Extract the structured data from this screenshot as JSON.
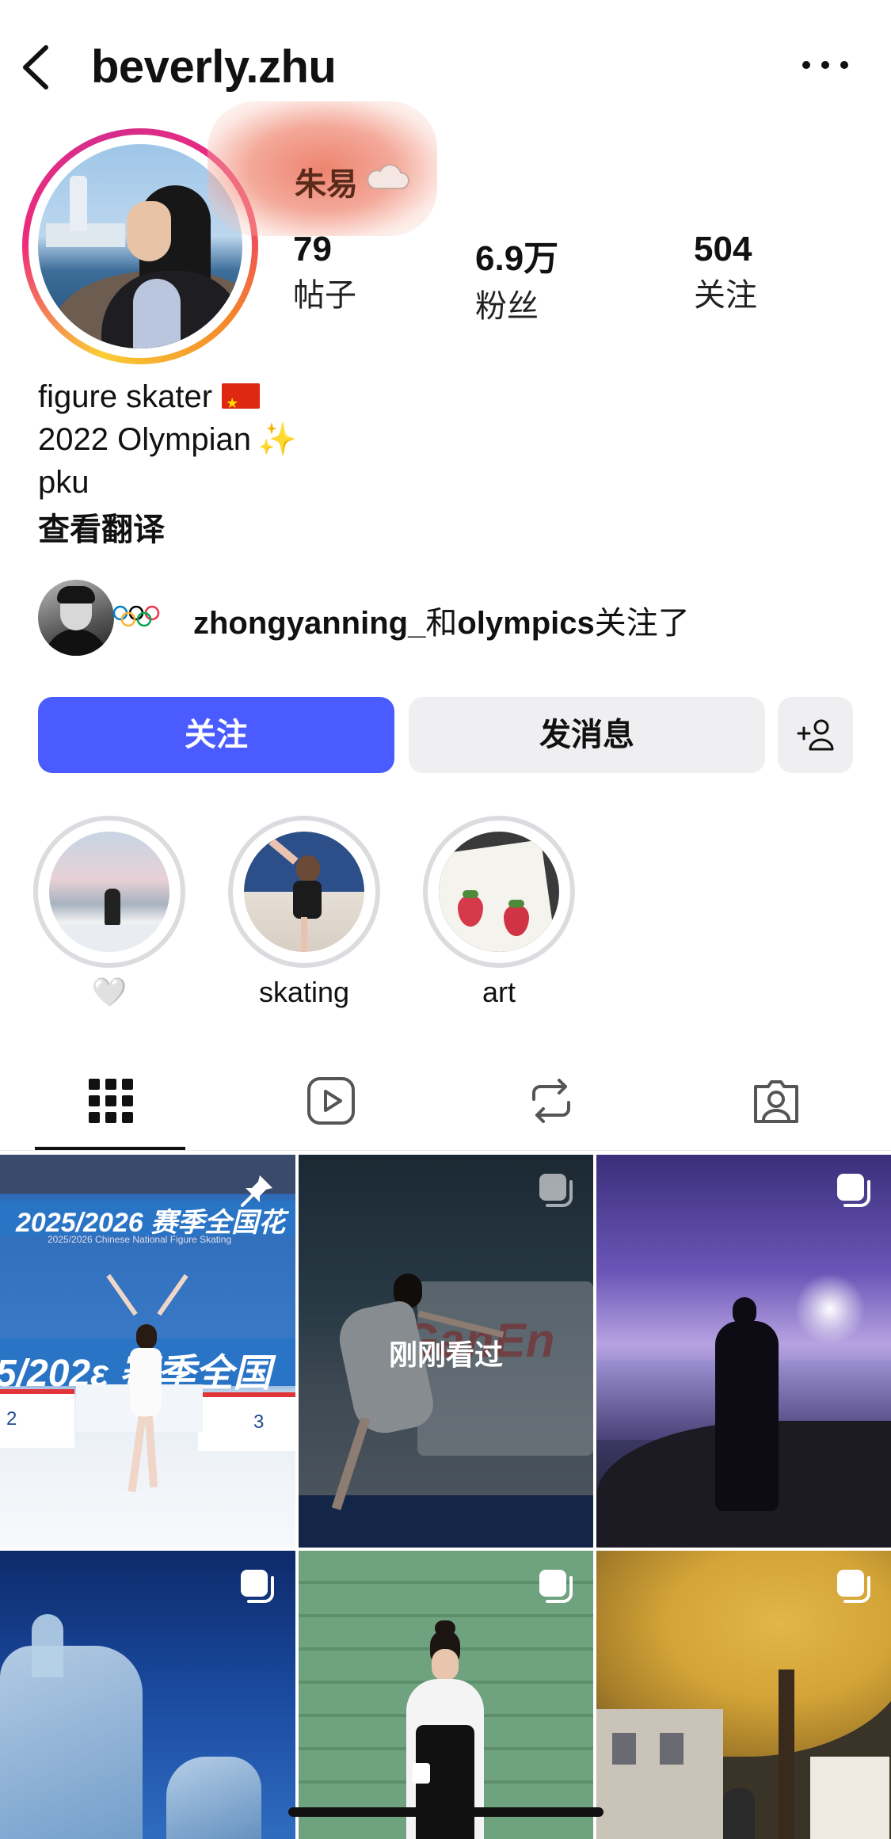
{
  "header": {
    "username": "beverly.zhu",
    "back_icon": "chevron-left-icon",
    "more_icon": "ellipsis-icon"
  },
  "profile": {
    "display_name": "朱易",
    "stats": [
      {
        "value": "79",
        "label": "帖子"
      },
      {
        "value": "6.9万",
        "label": "粉丝"
      },
      {
        "value": "504",
        "label": "关注"
      }
    ],
    "bio_lines": [
      "figure skater",
      "2022 Olympian",
      "pku"
    ],
    "translate_label": "查看翻译"
  },
  "followed_by": {
    "user1": "zhongyanning_",
    "connector": "和",
    "user2": "olympics",
    "suffix": "关注了"
  },
  "buttons": {
    "follow": "关注",
    "message": "发消息"
  },
  "highlights": [
    {
      "label": "🤍"
    },
    {
      "label": "skating"
    },
    {
      "label": "art"
    }
  ],
  "grid": {
    "recently_viewed_label": "刚刚看过",
    "banner_text_1": "2025/2026 赛季全国花",
    "banner_subtext_1": "2025/2026 Chinese National Figure Skating",
    "banner_text_2": "5/202ε 赛季全国",
    "banner_text_3": "GanEn",
    "podium_2": "2",
    "podium_3": "3"
  },
  "colors": {
    "accent": "#4a5cff",
    "secondary_button": "#efeff2"
  }
}
